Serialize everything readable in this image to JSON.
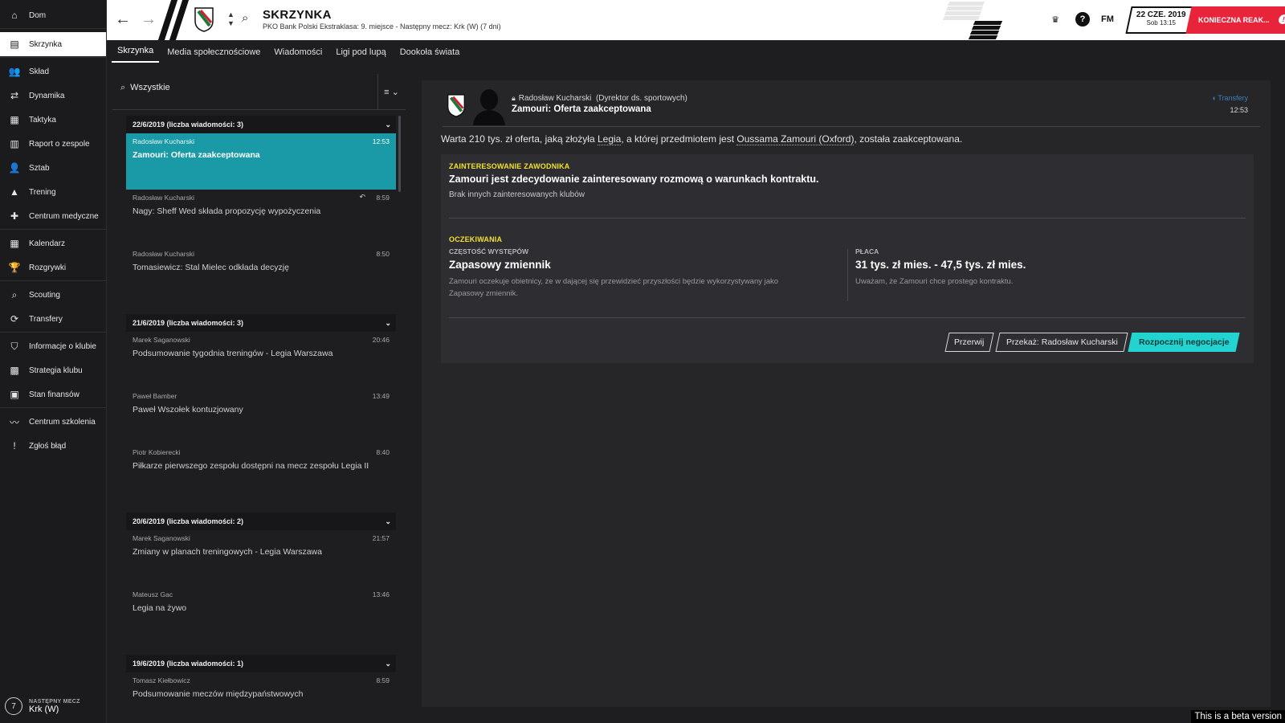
{
  "sidebar": {
    "items": [
      {
        "label": "Dom",
        "icon": "home-icon",
        "glyph": "⌂"
      },
      {
        "label": "Skrzynka",
        "icon": "inbox-icon",
        "glyph": "▤",
        "active": true
      },
      {
        "label": "Skład",
        "icon": "squad-icon",
        "glyph": "👥"
      },
      {
        "label": "Dynamika",
        "icon": "dynamics-icon",
        "glyph": "⇄"
      },
      {
        "label": "Taktyka",
        "icon": "tactics-icon",
        "glyph": "▦"
      },
      {
        "label": "Raport o zespole",
        "icon": "report-icon",
        "glyph": "▥"
      },
      {
        "label": "Sztab",
        "icon": "staff-icon",
        "glyph": "👤"
      },
      {
        "label": "Trening",
        "icon": "training-icon",
        "glyph": "▲"
      },
      {
        "label": "Centrum medyczne",
        "icon": "medical-icon",
        "glyph": "✚"
      },
      {
        "label": "Kalendarz",
        "icon": "calendar-icon",
        "glyph": "▦"
      },
      {
        "label": "Rozgrywki",
        "icon": "trophy-icon",
        "glyph": "🏆"
      },
      {
        "label": "Scouting",
        "icon": "scouting-icon",
        "glyph": "⌕"
      },
      {
        "label": "Transfery",
        "icon": "transfers-icon",
        "glyph": "⟳"
      },
      {
        "label": "Informacje o klubie",
        "icon": "club-info-icon",
        "glyph": "⛉"
      },
      {
        "label": "Strategia klubu",
        "icon": "strategy-icon",
        "glyph": "▩"
      },
      {
        "label": "Stan finansów",
        "icon": "finances-icon",
        "glyph": "▣"
      },
      {
        "label": "Centrum szkolenia",
        "icon": "coaching-icon",
        "glyph": "〰"
      },
      {
        "label": "Zgłoś błąd",
        "icon": "bug-report-icon",
        "glyph": "!"
      }
    ],
    "next_match": {
      "label": "NASTĘPNY MECZ",
      "value": "Krk (W)",
      "days": "7"
    }
  },
  "topbar": {
    "title": "SKRZYNKA",
    "subtitle": "PKO Bank Polski Ekstraklasa: 9. miejsce - Następny mecz: Krk (W) (7 dni)",
    "fm_label": "FM",
    "date_main": "22 CZE. 2019",
    "date_sub": "Sob 13:15",
    "action_label": "KONIECZNA REAK..."
  },
  "tabs": [
    {
      "label": "Skrzynka",
      "active": true
    },
    {
      "label": "Media społecznościowe"
    },
    {
      "label": "Wiadomości"
    },
    {
      "label": "Ligi pod lupą"
    },
    {
      "label": "Dookoła świata"
    }
  ],
  "inbox": {
    "search_value": "Wszystkie",
    "groups": [
      {
        "header": "22/6/2019 (liczba wiadomości: 3)",
        "messages": [
          {
            "from": "Radosław Kucharski",
            "subject": "Zamouri: Oferta zaakceptowana",
            "time": "12:53",
            "selected": true
          },
          {
            "from": "Radosław Kucharski",
            "subject": "Nagy: Sheff Wed składa propozycję wypożyczenia",
            "time": "8:59",
            "replied": true
          },
          {
            "from": "Radosław Kucharski",
            "subject": "Tomasiewicz: Stal Mielec odkłada decyzję",
            "time": "8:50"
          }
        ]
      },
      {
        "header": "21/6/2019 (liczba wiadomości: 3)",
        "messages": [
          {
            "from": "Marek Saganowski",
            "subject": "Podsumowanie tygodnia treningów - Legia Warszawa",
            "time": "20:46"
          },
          {
            "from": "Paweł Bamber",
            "subject": "Paweł Wszołek kontuzjowany",
            "time": "13:49"
          },
          {
            "from": "Piotr Kobierecki",
            "subject": "Piłkarze pierwszego zespołu dostępni na mecz zespołu Legia II",
            "time": "8:40"
          }
        ]
      },
      {
        "header": "20/6/2019 (liczba wiadomości: 2)",
        "messages": [
          {
            "from": "Marek Saganowski",
            "subject": "Zmiany w planach treningowych - Legia Warszawa",
            "time": "21:57"
          },
          {
            "from": "Mateusz Gac",
            "subject": "Legia na żywo",
            "time": "13:46"
          }
        ]
      },
      {
        "header": "19/6/2019 (liczba wiadomości: 1)",
        "messages": [
          {
            "from": "Tomasz Kiełbowicz",
            "subject": "Podsumowanie meczów międzypaństwowych",
            "time": "8:59"
          }
        ]
      }
    ]
  },
  "detail": {
    "sender": "Radosław Kucharski",
    "sender_role": "(Dyrektor ds. sportowych)",
    "subject": "Zamouri: Oferta zaakceptowana",
    "tag": "Transfery",
    "time": "12:53",
    "body_pre": "Warta 210 tys. zł oferta, jaką złożyła ",
    "body_club": "Legia",
    "body_mid": ", a której przedmiotem jest ",
    "body_player": "Oussama Zamouri (Oxford)",
    "body_post": ", została zaakceptowana.",
    "interest": {
      "title": "ZAINTERESOWANIE ZAWODNIKA",
      "headline": "Zamouri jest zdecydowanie zainteresowany rozmową o warunkach kontraktu.",
      "note": "Brak innych zainteresowanych klubów"
    },
    "expectations": {
      "title": "OCZEKIWANIA",
      "playing_time_label": "CZĘSTOŚĆ WYSTĘPÓW",
      "playing_time_value": "Zapasowy zmiennik",
      "playing_time_desc_1": "Zamouri oczekuje obietnicy, że w dającej się przewidzieć przyszłości będzie wykorzystywany jako",
      "playing_time_desc_2": "Zapasowy zmiennik.",
      "wage_label": "PŁACA",
      "wage_value": "31 tys. zł mies. - 47,5 tys. zł mies.",
      "wage_desc": "Uważam, że Zamouri chce prostego kontraktu."
    },
    "buttons": {
      "dismiss": "Przerwij",
      "delegate": "Przekaż: Radosław Kucharski",
      "negotiate": "Rozpocznij negocjacje"
    }
  },
  "colors": {
    "accent": "#1a9aa6",
    "negotiate": "#22d3cf",
    "warning": "#e8243a",
    "section_title": "#f2e02c"
  },
  "beta_notice": "This is a beta version"
}
